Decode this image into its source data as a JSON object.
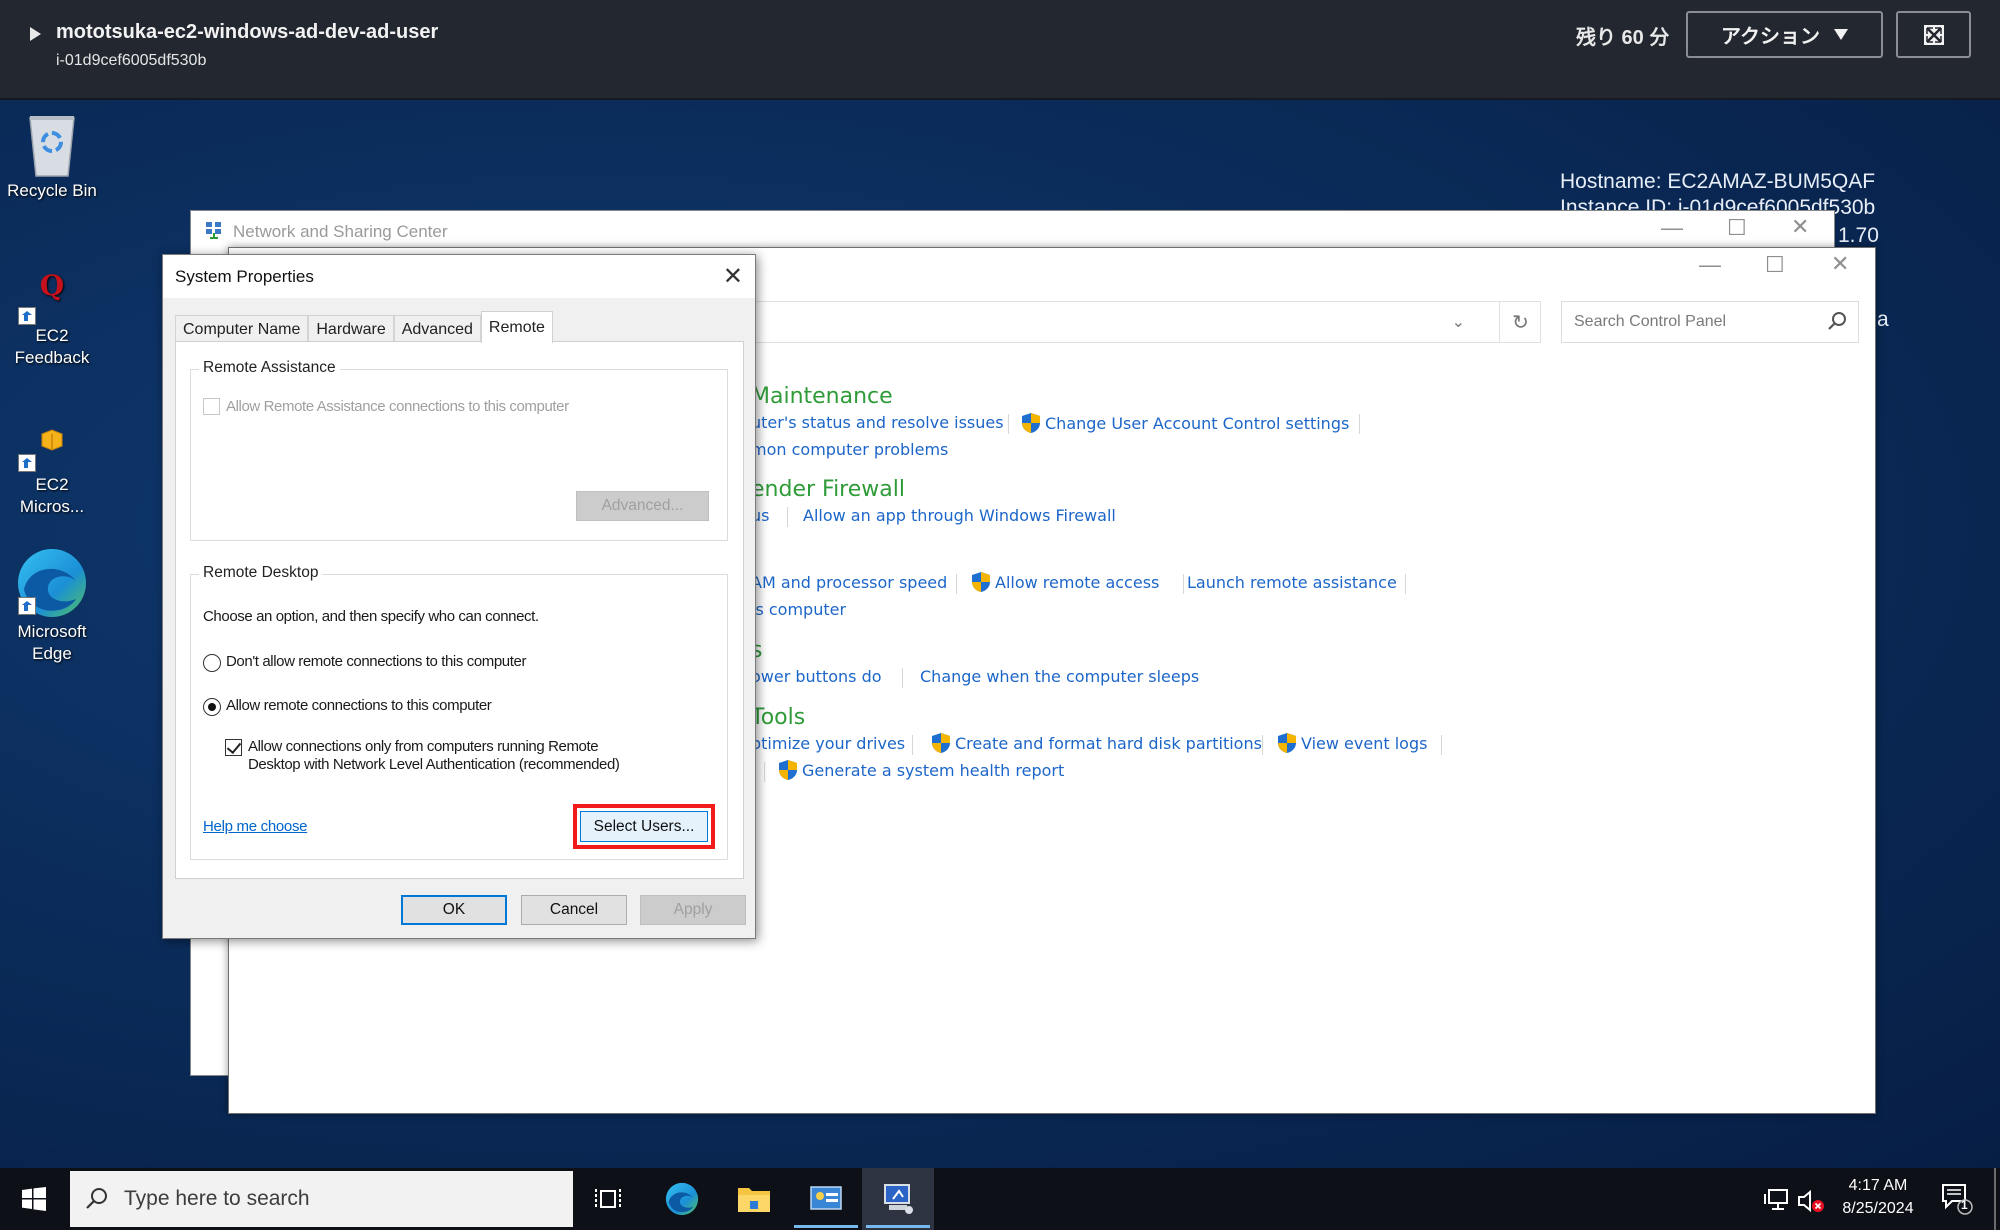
{
  "aws_bar": {
    "instance_name": "mototsuka-ec2-windows-ad-dev-ad-user",
    "instance_id": "i-01d9cef6005df530b",
    "remaining": "残り 60 分",
    "actions_label": "アクション",
    "icons": {
      "expand": "caret-right-icon",
      "dropdown": "triangle-down-icon",
      "fullscreen": "fullscreen-icon"
    }
  },
  "desktop": {
    "icons": [
      {
        "label_line1": "Recycle Bin",
        "label_line2": "",
        "icon": "recycle-bin-icon"
      },
      {
        "label_line1": "EC2",
        "label_line2": "Feedback",
        "icon": "ec2-feedback-icon"
      },
      {
        "label_line1": "EC2",
        "label_line2": "Micros...",
        "icon": "ec2-microsoft-icon"
      },
      {
        "label_line1": "Microsoft",
        "label_line2": "Edge",
        "icon": "edge-icon"
      }
    ],
    "bginfo": {
      "hostname": "Hostname: EC2AMAZ-BUM5QAF",
      "instance_line": "Instance ID: i-01d9cef6005df530b",
      "ip_fragment": "1.70",
      "fragment_a": "a"
    }
  },
  "network_window": {
    "title": "Network and Sharing Center"
  },
  "control_panel": {
    "search_placeholder": "Search Control Panel",
    "sections": [
      {
        "heading": "Maintenance",
        "row1": [
          {
            "label": "uter's status and resolve issues",
            "shield": false
          },
          {
            "label": "Change User Account Control settings",
            "shield": true
          }
        ],
        "row2": [
          {
            "label": "mon computer problems",
            "shield": false
          }
        ]
      },
      {
        "heading": "ender Firewall",
        "row1": [
          {
            "label": "us",
            "shield": false
          },
          {
            "label": "Allow an app through Windows Firewall",
            "shield": false
          }
        ]
      },
      {
        "heading": "",
        "row1": [
          {
            "label": "AM and processor speed",
            "shield": false
          },
          {
            "label": "Allow remote access",
            "shield": true
          },
          {
            "label": "Launch remote assistance",
            "shield": false
          }
        ],
        "row2": [
          {
            "label": "is computer",
            "shield": false
          }
        ]
      },
      {
        "heading": "s",
        "row1": [
          {
            "label": "ower buttons do",
            "shield": false
          },
          {
            "label": "Change when the computer sleeps",
            "shield": false
          }
        ]
      },
      {
        "heading": "Tools",
        "row1": [
          {
            "label": "ptimize your drives",
            "shield": false
          },
          {
            "label": "Create and format hard disk partitions",
            "shield": true
          },
          {
            "label": "View event logs",
            "shield": true
          }
        ],
        "row2": [
          {
            "label": "Generate a system health report",
            "shield": true
          }
        ]
      }
    ]
  },
  "system_properties": {
    "title": "System Properties",
    "tabs": [
      {
        "label": "Computer Name",
        "active": false
      },
      {
        "label": "Hardware",
        "active": false
      },
      {
        "label": "Advanced",
        "active": false
      },
      {
        "label": "Remote",
        "active": true
      }
    ],
    "remote_assistance": {
      "legend": "Remote Assistance",
      "checkbox_label": "Allow Remote Assistance connections to this computer",
      "checked": false,
      "enabled": false,
      "advanced_button": "Advanced..."
    },
    "remote_desktop": {
      "legend": "Remote Desktop",
      "instruction": "Choose an option, and then specify who can connect.",
      "option_deny": "Don't allow remote connections to this computer",
      "option_allow": "Allow remote connections to this computer",
      "selected": "allow",
      "nla_label_line1": "Allow connections only from computers running Remote",
      "nla_label_line2": "Desktop with Network Level Authentication (recommended)",
      "nla_checked": true,
      "help_link": "Help me choose",
      "select_users_button": "Select Users..."
    },
    "buttons": {
      "ok": "OK",
      "cancel": "Cancel",
      "apply": "Apply"
    },
    "highlight_color": "#f11b1b"
  },
  "taskbar": {
    "search_placeholder": "Type here to search",
    "apps": [
      "task-view",
      "edge",
      "file-explorer",
      "control-panel",
      "system-properties"
    ],
    "time": "4:17 AM",
    "date": "8/25/2024",
    "notification_count": "1"
  }
}
